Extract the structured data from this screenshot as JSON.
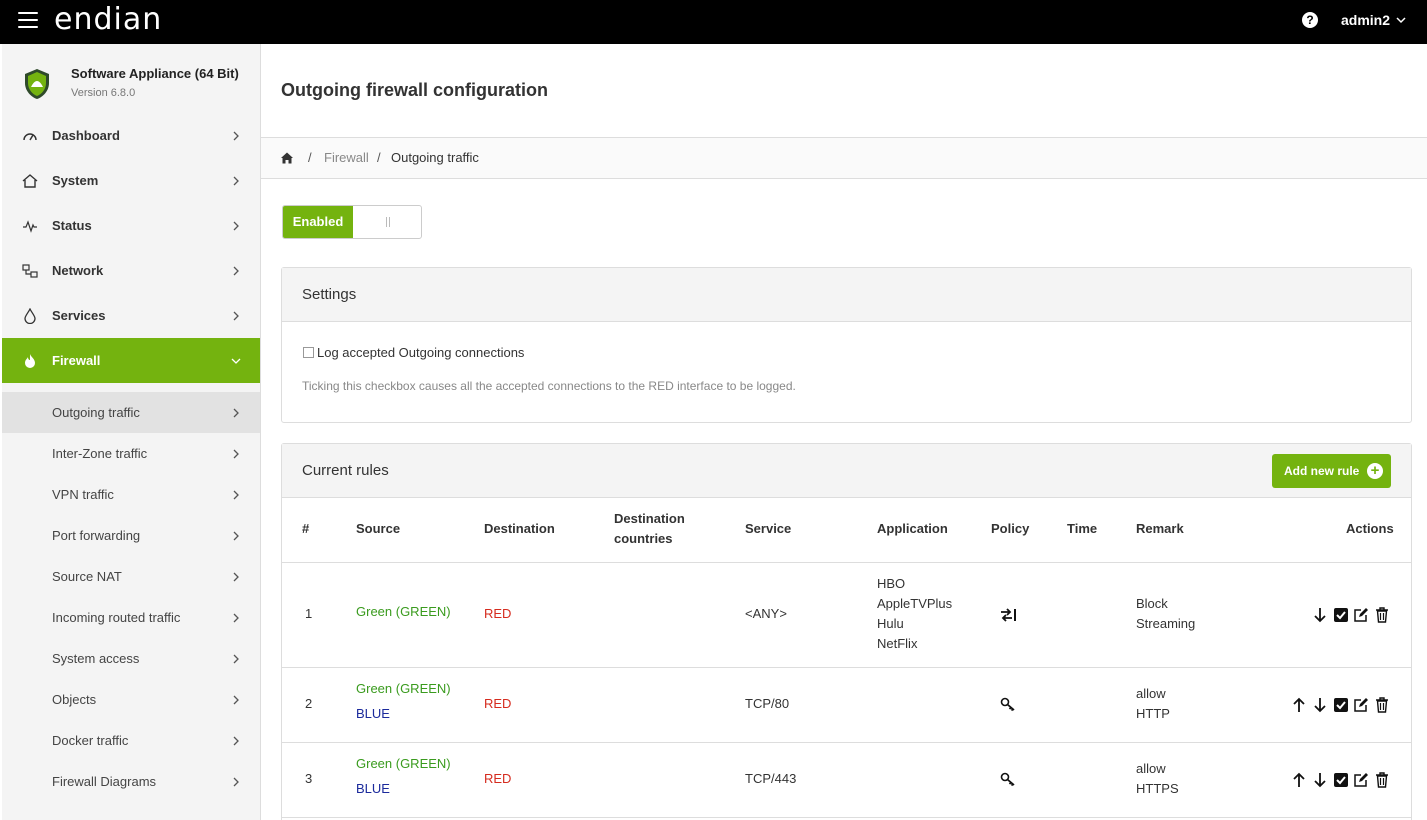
{
  "topbar": {
    "logo": "endian",
    "user": "admin2"
  },
  "product": {
    "name": "Software Appliance (64 Bit)",
    "version": "Version 6.8.0"
  },
  "nav": [
    {
      "label": "Dashboard",
      "icon": "gauge-icon"
    },
    {
      "label": "System",
      "icon": "home-icon"
    },
    {
      "label": "Status",
      "icon": "pulse-icon"
    },
    {
      "label": "Network",
      "icon": "network-icon"
    },
    {
      "label": "Services",
      "icon": "drop-icon"
    },
    {
      "label": "Firewall",
      "icon": "flame-icon",
      "active": true
    }
  ],
  "subnav": [
    "Outgoing traffic",
    "Inter-Zone traffic",
    "VPN traffic",
    "Port forwarding",
    "Source NAT",
    "Incoming routed traffic",
    "System access",
    "Objects",
    "Docker traffic",
    "Firewall Diagrams"
  ],
  "page": {
    "title": "Outgoing firewall configuration"
  },
  "breadcrumb": {
    "sep": "/",
    "parent": "Firewall",
    "current": "Outgoing traffic"
  },
  "toggle": {
    "label": "Enabled"
  },
  "settings": {
    "title": "Settings",
    "checkbox_label": "Log accepted Outgoing connections",
    "help": "Ticking this checkbox causes all the accepted connections to the RED interface to be logged."
  },
  "rules": {
    "title": "Current rules",
    "add_label": "Add new rule",
    "columns": {
      "num": "#",
      "source": "Source",
      "destination": "Destination",
      "dest_countries_1": "Destination",
      "dest_countries_2": "countries",
      "service": "Service",
      "application": "Application",
      "policy": "Policy",
      "time": "Time",
      "remark": "Remark",
      "actions": "Actions"
    },
    "rows": [
      {
        "num": "1",
        "source": [
          "Green (GREEN)"
        ],
        "destination": "RED",
        "service": "<ANY>",
        "application": [
          "HBO",
          "AppleTVPlus",
          "Hulu",
          "NetFlix"
        ],
        "policy": "reject-icon",
        "remark": [
          "Block",
          "Streaming"
        ]
      },
      {
        "num": "2",
        "source": [
          "Green (GREEN)",
          "BLUE"
        ],
        "destination": "RED",
        "service": "TCP/80",
        "application": [],
        "policy": "allow-icon",
        "remark": [
          "allow",
          "HTTP"
        ]
      },
      {
        "num": "3",
        "source": [
          "Green (GREEN)",
          "BLUE"
        ],
        "destination": "RED",
        "service": "TCP/443",
        "application": [],
        "policy": "allow-icon",
        "remark": [
          "allow",
          "HTTPS"
        ]
      }
    ]
  },
  "colors": {
    "accent": "#74b30f",
    "green_zone": "#3a9b1e",
    "red_zone": "#d52b1e",
    "blue_zone": "#1b2a9c"
  }
}
